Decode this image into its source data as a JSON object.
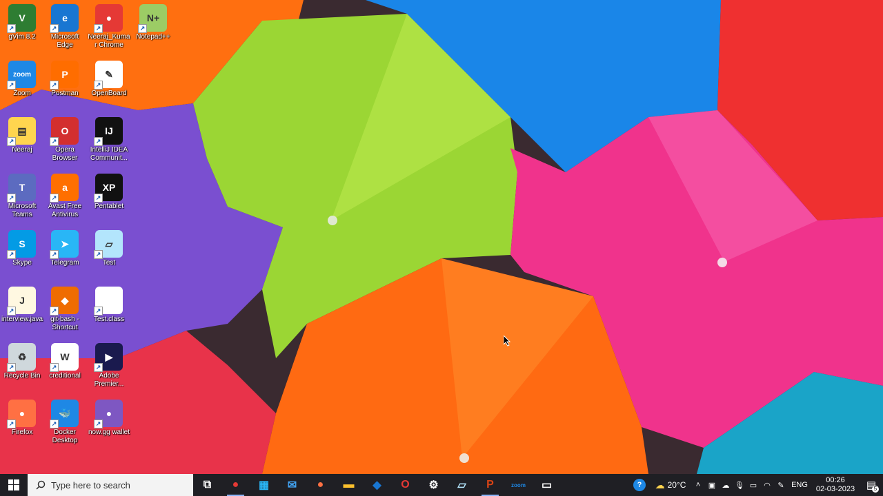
{
  "desktop_icons": [
    {
      "label": "gVim 8.2",
      "color": "#2e7d32",
      "glyph": "V"
    },
    {
      "label": "Microsoft Edge",
      "color": "#1976d2",
      "glyph": "e"
    },
    {
      "label": "Neeraj_Kumar Chrome",
      "color": "#e53935",
      "glyph": "●"
    },
    {
      "label": "Notepad++",
      "color": "#9ccc65",
      "glyph": "N+"
    },
    {
      "label": "Zoom",
      "color": "#1e88e5",
      "glyph": "zoom"
    },
    {
      "label": "Postman",
      "color": "#ff6d00",
      "glyph": "P"
    },
    {
      "label": "OpenBoard",
      "color": "#ffffff",
      "glyph": "✎"
    },
    {
      "label": "Neeraj",
      "color": "#ffd54f",
      "glyph": "▤"
    },
    {
      "label": "Opera Browser",
      "color": "#d32f2f",
      "glyph": "O"
    },
    {
      "label": "IntelliJ IDEA Communit...",
      "color": "#111111",
      "glyph": "IJ"
    },
    {
      "label": "Microsoft Teams",
      "color": "#5c6bc0",
      "glyph": "T"
    },
    {
      "label": "Avast Free Antivirus",
      "color": "#ff6f00",
      "glyph": "a"
    },
    {
      "label": "Pentablet",
      "color": "#111111",
      "glyph": "XP"
    },
    {
      "label": "Skype",
      "color": "#039be5",
      "glyph": "S"
    },
    {
      "label": "Telegram",
      "color": "#29b6f6",
      "glyph": "➤"
    },
    {
      "label": "Test",
      "color": "#b3e5fc",
      "glyph": "▱"
    },
    {
      "label": "interview.java",
      "color": "#fff8e1",
      "glyph": "J"
    },
    {
      "label": "git-bash - Shortcut",
      "color": "#ef6c00",
      "glyph": "◆"
    },
    {
      "label": "Test.class",
      "color": "#ffffff",
      "glyph": ""
    },
    {
      "label": "Recycle Bin",
      "color": "#cfd8dc",
      "glyph": "♻"
    },
    {
      "label": "creditional",
      "color": "#ffffff",
      "glyph": "W"
    },
    {
      "label": "Adobe Premier...",
      "color": "#1a1a4e",
      "glyph": "▶"
    },
    {
      "label": "Firefox",
      "color": "#ff7043",
      "glyph": "●"
    },
    {
      "label": "Docker Desktop",
      "color": "#1e88e5",
      "glyph": "🐳"
    },
    {
      "label": "now.gg wallet",
      "color": "#7e57c2",
      "glyph": "●"
    }
  ],
  "taskbar": {
    "search_placeholder": "Type here to search",
    "apps": [
      {
        "name": "task-view",
        "glyph": "⧉",
        "color": "#ffffff"
      },
      {
        "name": "chrome",
        "glyph": "●",
        "color": "#e53935"
      },
      {
        "name": "microsoft-store",
        "glyph": "▦",
        "color": "#29b6f6"
      },
      {
        "name": "mail",
        "glyph": "✉",
        "color": "#42a5f5"
      },
      {
        "name": "firefox",
        "glyph": "●",
        "color": "#ff7043"
      },
      {
        "name": "file-explorer",
        "glyph": "▬",
        "color": "#fbc02d"
      },
      {
        "name": "dropbox",
        "glyph": "◆",
        "color": "#1976d2"
      },
      {
        "name": "opera",
        "glyph": "O",
        "color": "#e53935"
      },
      {
        "name": "settings",
        "glyph": "⚙",
        "color": "#ffffff"
      },
      {
        "name": "notes",
        "glyph": "▱",
        "color": "#b3e5fc"
      },
      {
        "name": "powerpoint",
        "glyph": "P",
        "color": "#d84315"
      },
      {
        "name": "zoom",
        "glyph": "zoom",
        "color": "#1e88e5"
      },
      {
        "name": "terminal",
        "glyph": "▭",
        "color": "#ffffff"
      }
    ],
    "weather": "20°C",
    "language": "ENG",
    "time": "00:26",
    "date": "02-03-2023",
    "notification_count": "5"
  }
}
